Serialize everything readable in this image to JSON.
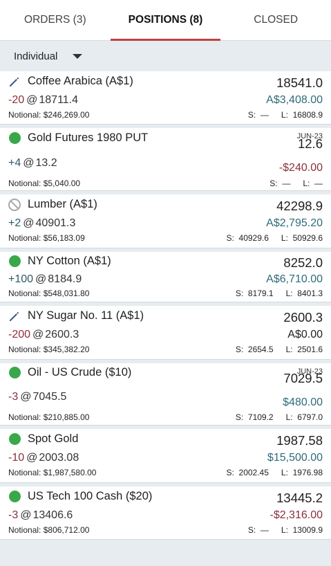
{
  "tabs": [
    {
      "label": "ORDERS (3)",
      "active": false
    },
    {
      "label": "POSITIONS (8)",
      "active": true
    },
    {
      "label": "CLOSED",
      "active": false
    }
  ],
  "account_filter": {
    "selected": "Individual"
  },
  "positions": [
    {
      "icon": "pencil-icon",
      "name": "Coffee Arabica (A$1)",
      "qty": "-20",
      "at": "@",
      "entry": "18711.4",
      "notional_label": "Notional:",
      "notional": "$246,269.00",
      "expiry": "",
      "price": "18541.0",
      "pnl": "A$3,408.00",
      "pnl_sign": "pos",
      "s_label": "S:",
      "s": "—",
      "l_label": "L:",
      "l": "16808.9"
    },
    {
      "icon": "green-dot-icon",
      "name": "Gold Futures 1980 PUT",
      "qty": "+4",
      "at": "@",
      "entry": "13.2",
      "notional_label": "Notional:",
      "notional": "$5,040.00",
      "expiry": "JUN-23",
      "price": "12.6",
      "pnl": "-$240.00",
      "pnl_sign": "neg",
      "s_label": "S:",
      "s": "—",
      "l_label": "L:",
      "l": "—"
    },
    {
      "icon": "ban-icon",
      "name": "Lumber (A$1)",
      "qty": "+2",
      "at": "@",
      "entry": "40901.3",
      "notional_label": "Notional:",
      "notional": "$56,183.09",
      "expiry": "",
      "price": "42298.9",
      "pnl": "A$2,795.20",
      "pnl_sign": "pos",
      "s_label": "S:",
      "s": "40929.6",
      "l_label": "L:",
      "l": "50929.6"
    },
    {
      "icon": "green-dot-icon",
      "name": "NY Cotton (A$1)",
      "qty": "+100",
      "at": "@",
      "entry": "8184.9",
      "notional_label": "Notional:",
      "notional": "$548,031.80",
      "expiry": "",
      "price": "8252.0",
      "pnl": "A$6,710.00",
      "pnl_sign": "pos",
      "s_label": "S:",
      "s": "8179.1",
      "l_label": "L:",
      "l": "8401.3"
    },
    {
      "icon": "pencil-icon",
      "name": "NY Sugar No. 11 (A$1)",
      "qty": "-200",
      "at": "@",
      "entry": "2600.3",
      "notional_label": "Notional:",
      "notional": "$345,382.20",
      "expiry": "",
      "price": "2600.3",
      "pnl": "A$0.00",
      "pnl_sign": "zero",
      "s_label": "S:",
      "s": "2654.5",
      "l_label": "L:",
      "l": "2501.6"
    },
    {
      "icon": "green-dot-icon",
      "name": "Oil - US Crude ($10)",
      "qty": "-3",
      "at": "@",
      "entry": "7045.5",
      "notional_label": "Notional:",
      "notional": "$210,885.00",
      "expiry": "JUN-23",
      "price": "7029.5",
      "pnl": "$480.00",
      "pnl_sign": "pos",
      "s_label": "S:",
      "s": "7109.2",
      "l_label": "L:",
      "l": "6797.0"
    },
    {
      "icon": "green-dot-icon",
      "name": "Spot Gold",
      "qty": "-10",
      "at": "@",
      "entry": "2003.08",
      "notional_label": "Notional:",
      "notional": "$1,987,580.00",
      "expiry": "",
      "price": "1987.58",
      "pnl": "$15,500.00",
      "pnl_sign": "pos",
      "s_label": "S:",
      "s": "2002.45",
      "l_label": "L:",
      "l": "1976.98"
    },
    {
      "icon": "green-dot-icon",
      "name": "US Tech 100 Cash ($20)",
      "qty": "-3",
      "at": "@",
      "entry": "13406.6",
      "notional_label": "Notional:",
      "notional": "$806,712.00",
      "expiry": "",
      "price": "13445.2",
      "pnl": "-$2,316.00",
      "pnl_sign": "neg",
      "s_label": "S:",
      "s": "—",
      "l_label": "L:",
      "l": "13009.9"
    }
  ],
  "colors": {
    "accent": "#c0413f",
    "positive": "#2f6b7a",
    "negative": "#8b2f3a",
    "status_green": "#3aa84a"
  }
}
